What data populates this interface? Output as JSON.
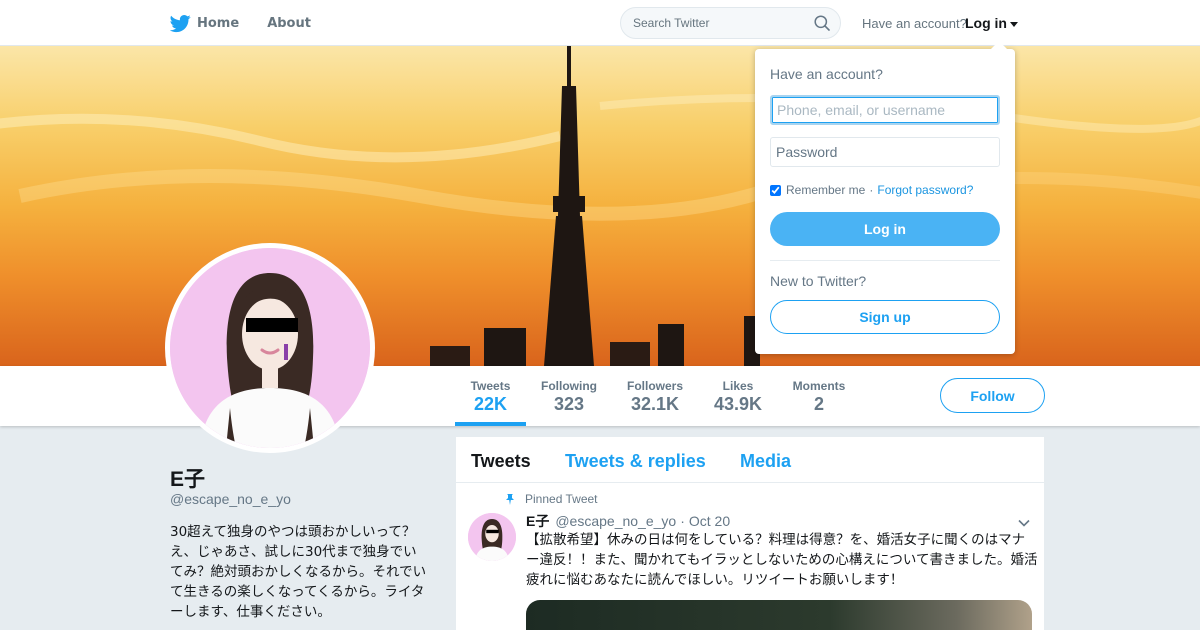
{
  "colors": {
    "brand": "#1da1f2",
    "text_primary": "#14171a",
    "text_secondary": "#657786",
    "avatar_bg": "#f3c5ef",
    "page_bg": "#e6ecf0"
  },
  "nav": {
    "home_label": "Home",
    "about_label": "About",
    "search_placeholder": "Search Twitter",
    "have_account_text": "Have an account?",
    "login_label": "Log in"
  },
  "login_dropdown": {
    "heading": "Have an account?",
    "username_placeholder": "Phone, email, or username",
    "password_placeholder": "Password",
    "remember_label": "Remember me",
    "separator": "·",
    "forgot_label": "Forgot password?",
    "login_button": "Log in",
    "new_to_text": "New to Twitter?",
    "signup_button": "Sign up"
  },
  "profile_nav": {
    "stats": [
      {
        "label": "Tweets",
        "value": "22K",
        "active": true
      },
      {
        "label": "Following",
        "value": "323",
        "active": false
      },
      {
        "label": "Followers",
        "value": "32.1K",
        "active": false
      },
      {
        "label": "Likes",
        "value": "43.9K",
        "active": false
      },
      {
        "label": "Moments",
        "value": "2",
        "active": false
      }
    ],
    "follow_button": "Follow"
  },
  "profile": {
    "name": "E子",
    "handle": "@escape_no_e_yo",
    "bio": "30超えて独身のやつは頭おかしいって？え、じゃあさ、試しに30代まで独身でいてみ？絶対頭おかしくなるから。それでいて生きるの楽しくなってくるから。ライターします、仕事ください。"
  },
  "timeline": {
    "tabs": [
      "Tweets",
      "Tweets & replies",
      "Media"
    ],
    "pinned_label": "Pinned Tweet",
    "tweet": {
      "name": "E子",
      "handle": "@escape_no_e_yo",
      "separator": "·",
      "date": "Oct 20",
      "text": "【拡散希望】休みの日は何をしている？料理は得意？を、婚活女子に聞くのはマナー違反！！また、聞かれてもイラッとしないための心構えについて書きました。婚活疲れに悩むあなたに読んでほしい。リツイートお願いします！"
    }
  }
}
